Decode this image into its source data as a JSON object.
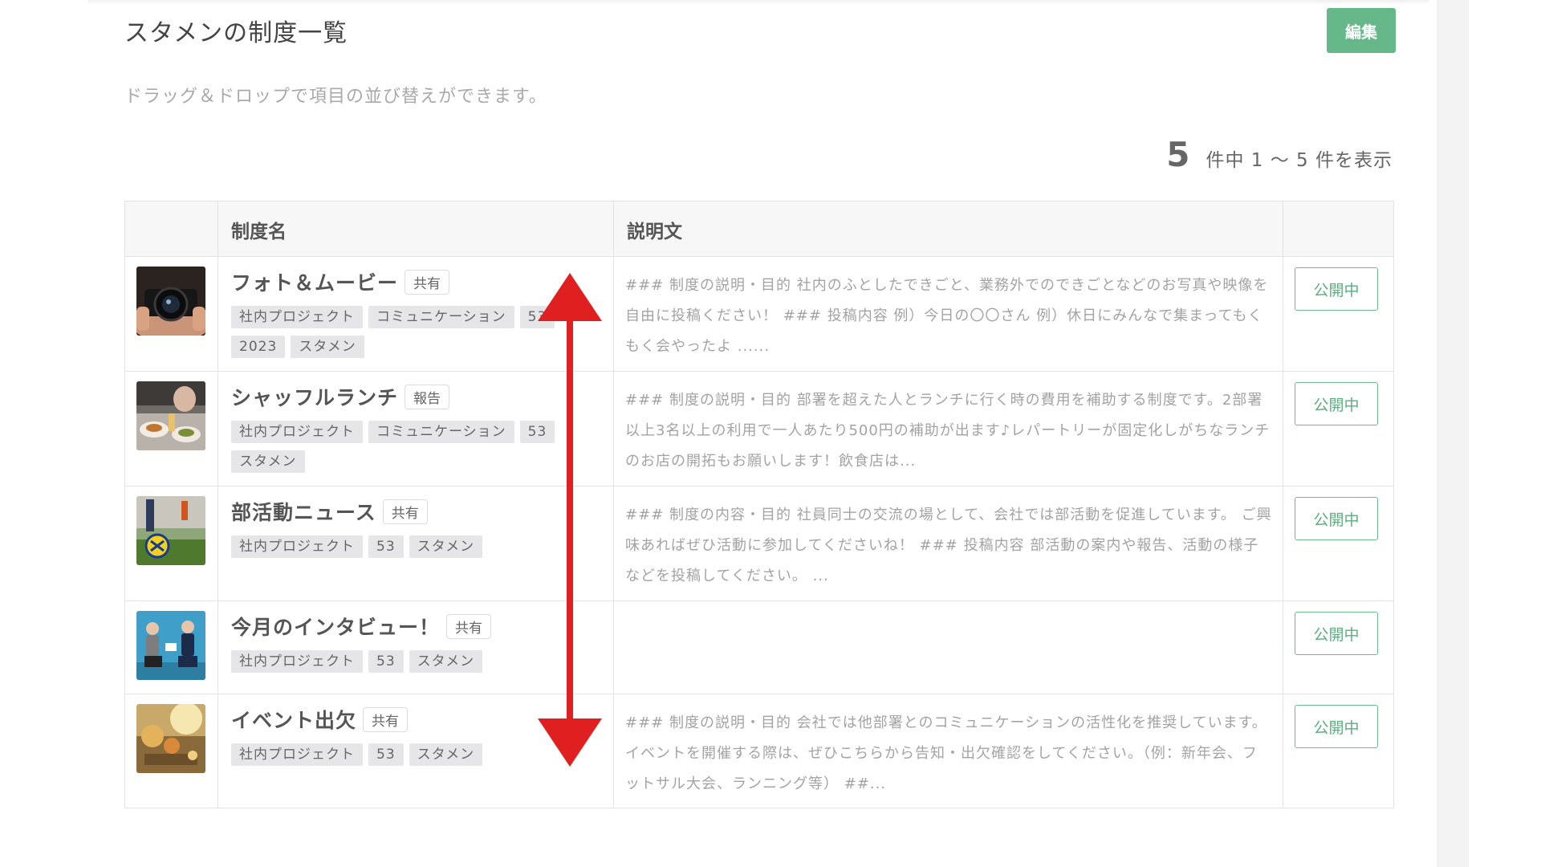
{
  "page": {
    "title": "スタメンの制度一覧",
    "edit_label": "編集",
    "hint": "ドラッグ＆ドロップで項目の並び替えができます。",
    "count": "5",
    "count_text": "件中 1 〜 5 件を表示"
  },
  "table": {
    "headers": {
      "thumb": "",
      "name": "制度名",
      "description": "説明文",
      "status": ""
    },
    "rows": [
      {
        "title": "フォト＆ムービー",
        "badge": "共有",
        "tags": [
          "社内プロジェクト",
          "コミュニケーション",
          "53",
          "2023",
          "スタメン"
        ],
        "description": "### 制度の説明・目的 社内のふとしたできごと、業務外でのできごとなどのお写真や映像を自由に投稿ください！ ### 投稿内容 例）今日の〇〇さん 例）休日にみんなで集まってもくもく会やったよ ......",
        "status": "公開中",
        "thumb_icon": "camera-photo"
      },
      {
        "title": "シャッフルランチ",
        "badge": "報告",
        "tags": [
          "社内プロジェクト",
          "コミュニケーション",
          "53",
          "スタメン"
        ],
        "description": "### 制度の説明・目的 部署を超えた人とランチに行く時の費用を補助する制度です。2部署以上3名以上の利用で一人あたり500円の補助が出ます♪レパートリーが固定化しがちなランチのお店の開拓もお願いします！飲食店は...",
        "status": "公開中",
        "thumb_icon": "lunch-photo"
      },
      {
        "title": "部活動ニュース",
        "badge": "共有",
        "tags": [
          "社内プロジェクト",
          "53",
          "スタメン"
        ],
        "description": "### 制度の内容・目的 社員同士の交流の場として、会社では部活動を促進しています。 ご興味あればぜひ活動に参加してくださいね！ ### 投稿内容 部活動の案内や報告、活動の様子などを投稿してください。 ...",
        "status": "公開中",
        "thumb_icon": "soccer-photo"
      },
      {
        "title": "今月のインタビュー！",
        "badge": "共有",
        "tags": [
          "社内プロジェクト",
          "53",
          "スタメン"
        ],
        "description": "",
        "status": "公開中",
        "thumb_icon": "interview-illustration"
      },
      {
        "title": "イベント出欠",
        "badge": "共有",
        "tags": [
          "社内プロジェクト",
          "53",
          "スタメン"
        ],
        "description": "### 制度の説明・目的 会社では他部署とのコミュニケーションの活性化を推奨しています。イベントを開催する際は、ぜひこちらから告知・出欠確認をしてください。（例：新年会、フットサル大会、ランニング等） ##...",
        "status": "公開中",
        "thumb_icon": "event-photo"
      }
    ]
  },
  "colors": {
    "accent_green": "#66b88a",
    "arrow_red": "#e02020"
  }
}
